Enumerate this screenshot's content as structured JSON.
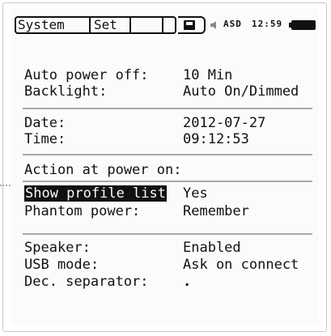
{
  "status_bar": {
    "tabs": [
      "System",
      "Set",
      "",
      ""
    ],
    "device_label": "ASD",
    "clock": "12:59"
  },
  "settings": {
    "auto_power_off": {
      "label": "Auto power off:",
      "value": "10 Min"
    },
    "backlight": {
      "label": "Backlight:",
      "value": "Auto On/Dimmed"
    },
    "date": {
      "label": "Date:",
      "value": "2012-07-27"
    },
    "time": {
      "label": "Time:",
      "value": "09:12:53"
    },
    "action_header": "Action at power on:",
    "show_profile_list": {
      "label": "Show profile list",
      "value": "Yes"
    },
    "phantom_power": {
      "label": "Phantom power:",
      "value": "Remember"
    },
    "speaker": {
      "label": "Speaker:",
      "value": "Enabled"
    },
    "usb_mode": {
      "label": "USB mode:",
      "value": "Ask on connect"
    },
    "dec_separator": {
      "label": "Dec. separator:",
      "value": "."
    }
  },
  "colors": {
    "selected_bg": "#111111",
    "selected_fg": "#fbfbfb",
    "divider": "#a8a8a8"
  },
  "icons": [
    "save-icon",
    "speaker-icon",
    "battery-icon"
  ]
}
